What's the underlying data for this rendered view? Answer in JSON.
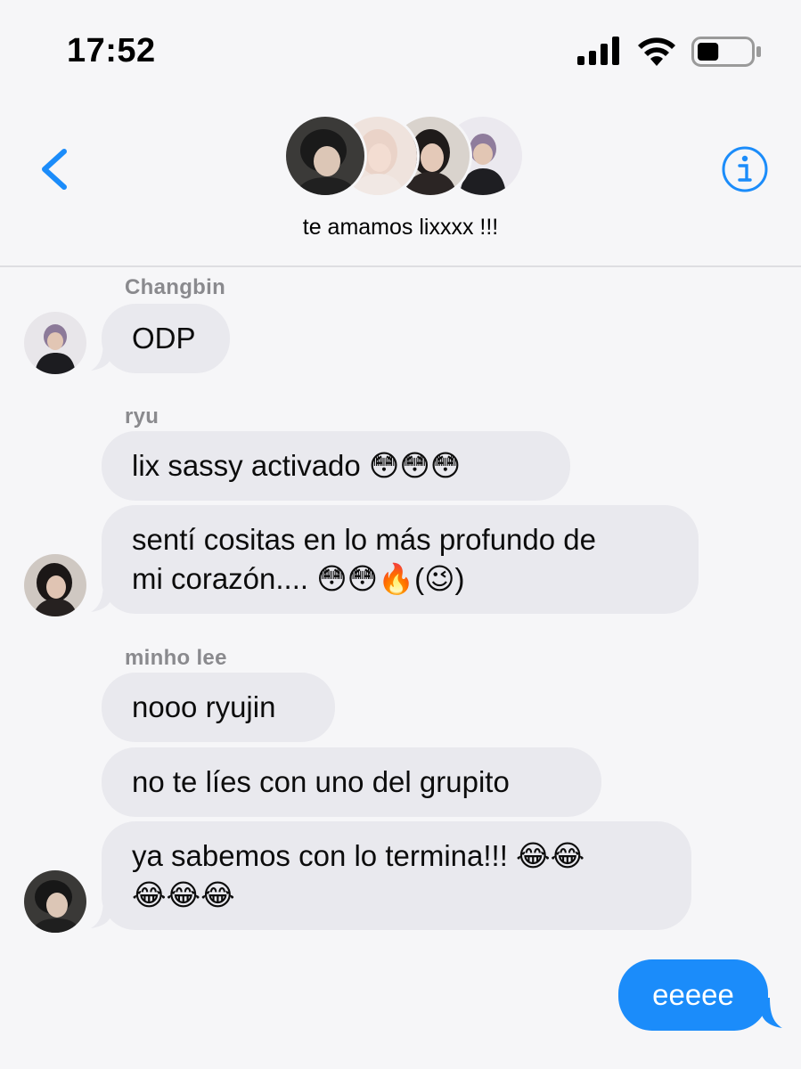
{
  "status_bar": {
    "time": "17:52",
    "signal_icon": "cellular-signal-icon",
    "wifi_icon": "wifi-icon",
    "battery_icon": "battery-icon",
    "battery_level_percent": 40
  },
  "header": {
    "back_icon": "chevron-left-icon",
    "info_icon": "info-icon",
    "group_name": "te amamos lixxxx !!!",
    "accent_color": "#1b8cfa"
  },
  "messages": [
    {
      "sender": "Changbin",
      "bubbles": [
        "ODP"
      ]
    },
    {
      "sender": "ryu",
      "bubbles": [
        "lix sassy activado 😳😳😳",
        "sentí cositas en lo más profundo de",
        "mi corazón.... 😳😳🔥(😉)"
      ]
    },
    {
      "sender": "minho lee",
      "bubbles": [
        "nooo ryujin",
        "no te líes con uno del grupito",
        "ya sabemos con lo termina!!! 😂😂",
        "😂😂😂"
      ]
    },
    {
      "sender": "",
      "bubbles": [
        "eeeee"
      ],
      "outgoing": true
    }
  ],
  "colors": {
    "incoming_bubble": "#e9e9ee",
    "outgoing_bubble": "#1b8cfa",
    "sender_name": "#8a8a8e",
    "background": "#f6f6f8"
  }
}
